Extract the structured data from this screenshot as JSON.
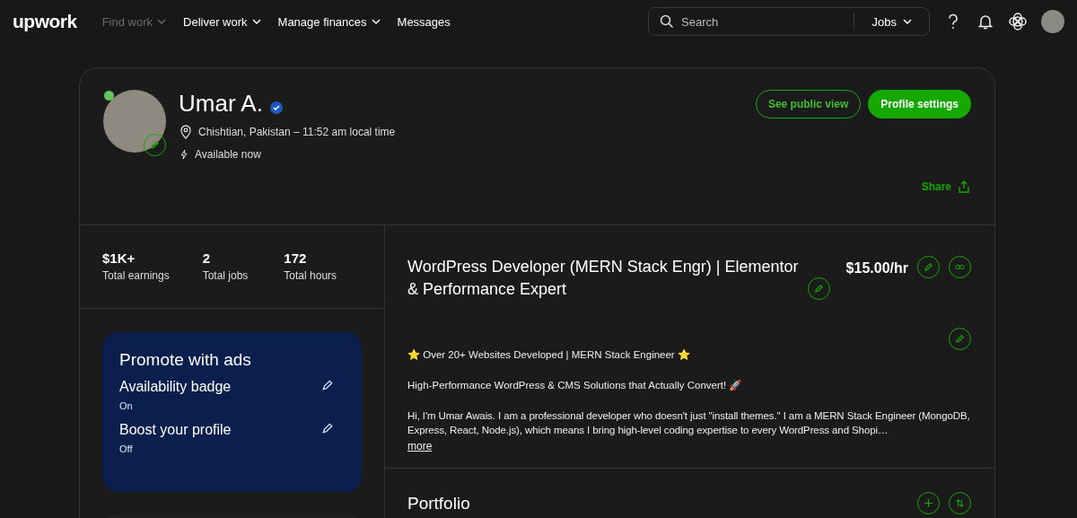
{
  "nav": {
    "logo": "upwork",
    "items": [
      {
        "label": "Find work",
        "disabled": true,
        "menu": true
      },
      {
        "label": "Deliver work",
        "disabled": false,
        "menu": true
      },
      {
        "label": "Manage finances",
        "disabled": false,
        "menu": true
      },
      {
        "label": "Messages",
        "disabled": false,
        "menu": false
      }
    ],
    "search": {
      "placeholder": "Search",
      "scope": "Jobs"
    }
  },
  "profile": {
    "name": "Umar A.",
    "online": true,
    "verified": true,
    "location": "Chishtian, Pakistan – 11:52 am local time",
    "availability": "Available now",
    "buttons": [
      "See public view",
      "Profile settings"
    ],
    "share": "Share"
  },
  "stats": [
    {
      "value": "$1K+",
      "label": "Total earnings"
    },
    {
      "value": "2",
      "label": "Total jobs"
    },
    {
      "value": "172",
      "label": "Total hours"
    }
  ],
  "promo": {
    "title": "Promote with ads",
    "settings": [
      {
        "label": "Availability badge",
        "value": "On"
      },
      {
        "label": "Boost your profile",
        "value": "Off"
      }
    ]
  },
  "headline": {
    "title": "WordPress Developer (MERN Stack Engr) | Elementor & Performance Expert",
    "rate": "$15.00/hr"
  },
  "bio": {
    "paragraphs": [
      "⭐ Over 20+ Websites Developed | MERN Stack Engineer ⭐",
      "High-Performance WordPress & CMS Solutions that Actually Convert! 🚀",
      "Hi, I'm Umar Awais. I am a professional developer who doesn't just \"install themes.\" I am a MERN Stack Engineer (MongoDB, Express, React, Node.js), which means I bring high-level coding expertise to every WordPress and Shopi…"
    ],
    "more": "more"
  },
  "portfolio": {
    "title": "Portfolio"
  }
}
